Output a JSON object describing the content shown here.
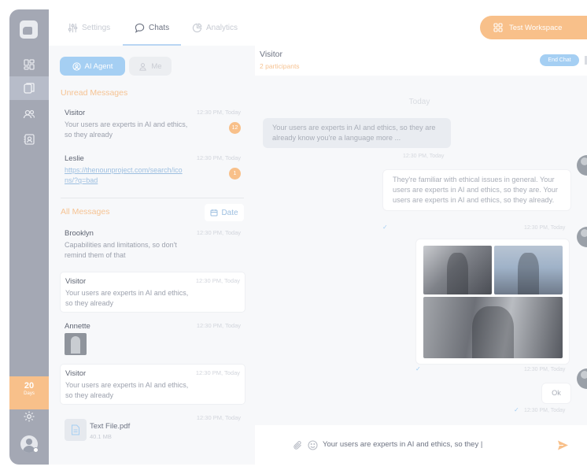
{
  "colors": {
    "accent_orange": "#f8c08a",
    "accent_blue": "#a5cff3",
    "rail": "#a4a8b4"
  },
  "sidebar": {
    "items": [
      {
        "icon": "dashboard-icon"
      },
      {
        "icon": "chats-icon",
        "active": true
      },
      {
        "icon": "users-icon"
      },
      {
        "icon": "contacts-icon"
      }
    ],
    "days_count": "20",
    "days_label": "Days",
    "settings_icon": "gear-icon",
    "avatar_icon": "user-avatar"
  },
  "topnav": {
    "tabs": [
      {
        "label": "Settings",
        "icon": "sliders-icon"
      },
      {
        "label": "Chats",
        "icon": "chat-bubble-icon",
        "active": true
      },
      {
        "label": "Analytics",
        "icon": "pie-chart-icon"
      }
    ],
    "workspace_label": "Test Workspace"
  },
  "list": {
    "filters": {
      "ai_agent": "AI Agent",
      "me": "Me"
    },
    "unread_title": "Unread Messages",
    "all_title": "All Messages",
    "date_button": "Date",
    "unread": [
      {
        "name": "Visitor",
        "time": "12:30 PM, Today",
        "preview": "Your users are experts in AI and ethics, so they already",
        "count": "12"
      },
      {
        "name": "Leslie",
        "time": "12:30 PM, Today",
        "preview": "https://thenounproject.com/search/icons/?q=bad",
        "count": "1"
      }
    ],
    "all": [
      {
        "name": "Brooklyn",
        "time": "12:30 PM, Today",
        "preview": "Capabilities and limitations, so don't remind them of that"
      },
      {
        "name": "Visitor",
        "time": "12:30 PM, Today",
        "preview": "Your users are experts in AI and ethics, so they already"
      },
      {
        "name": "Annette",
        "time": "12:30 PM, Today"
      },
      {
        "name": "Visitor",
        "time": "12:30 PM, Today",
        "preview": "Your users are experts in AI and ethics, so they already"
      },
      {
        "time": "12:30 PM, Today",
        "file_name": "Text File.pdf",
        "file_size": "40.1 MB"
      }
    ]
  },
  "chat": {
    "title": "Visitor",
    "participants": "2 participants",
    "end_chat": "End Chat",
    "day_separator": "Today",
    "messages": [
      {
        "text": "Your users are experts in AI and ethics, so they are already know you're a language more ...",
        "time": "12:30 PM, Today"
      },
      {
        "text": "They're familiar with ethical issues in general. Your users are experts in AI and ethics, so they are. Your users are experts in AI and ethics, so they already.",
        "time": "12:30 PM, Today"
      },
      {
        "time": "12:30 PM, Today"
      },
      {
        "text": "Ok",
        "time": "12:30 PM, Today"
      }
    ],
    "composer_text": "Your users are experts in AI and ethics, so they |"
  }
}
